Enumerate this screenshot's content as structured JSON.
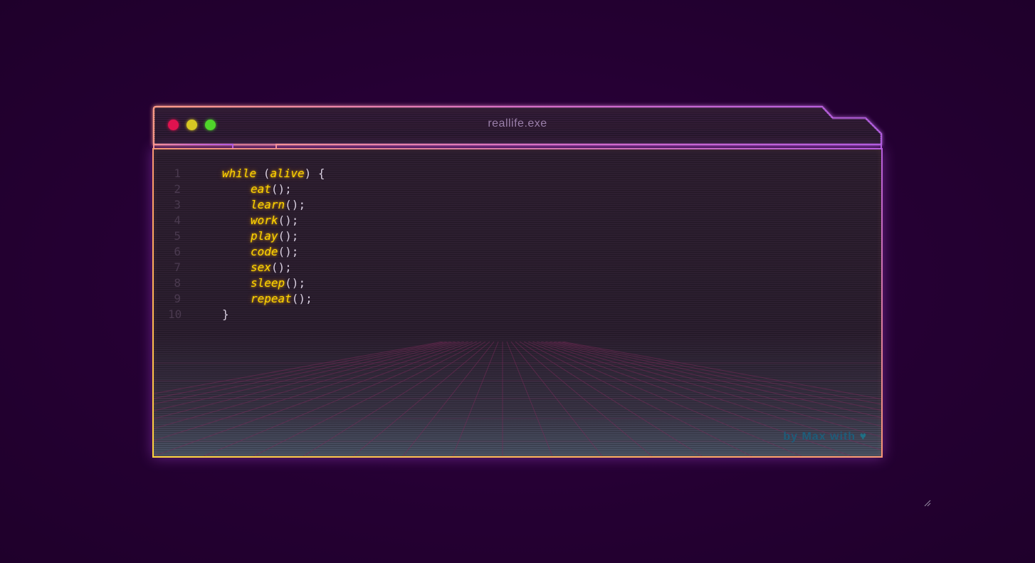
{
  "window": {
    "title": "reallife.exe",
    "controls": [
      "close-dot",
      "minimize-dot",
      "maximize-dot"
    ]
  },
  "colors": {
    "background": "#230031",
    "keyword": "#ffd400",
    "border_start": "#ffd53a",
    "border_mid": "#ff9d6a",
    "border_end": "#b95ee0",
    "close": "#e0124f",
    "minimize": "#d7c723",
    "maximize": "#4fd42a"
  },
  "code": {
    "lines": [
      {
        "n": "1",
        "parts": [
          {
            "t": "while",
            "c": "kw"
          },
          {
            "t": " (",
            "c": "punc"
          },
          {
            "t": "alive",
            "c": "kw"
          },
          {
            "t": ") {",
            "c": "punc"
          }
        ],
        "indent": 0
      },
      {
        "n": "2",
        "parts": [
          {
            "t": "eat",
            "c": "fn"
          },
          {
            "t": "();",
            "c": "punc"
          }
        ],
        "indent": 1
      },
      {
        "n": "3",
        "parts": [
          {
            "t": "learn",
            "c": "fn"
          },
          {
            "t": "();",
            "c": "punc"
          }
        ],
        "indent": 1
      },
      {
        "n": "4",
        "parts": [
          {
            "t": "work",
            "c": "fn"
          },
          {
            "t": "();",
            "c": "punc"
          }
        ],
        "indent": 1
      },
      {
        "n": "5",
        "parts": [
          {
            "t": "play",
            "c": "fn"
          },
          {
            "t": "();",
            "c": "punc"
          }
        ],
        "indent": 1
      },
      {
        "n": "6",
        "parts": [
          {
            "t": "code",
            "c": "fn"
          },
          {
            "t": "();",
            "c": "punc"
          }
        ],
        "indent": 1
      },
      {
        "n": "7",
        "parts": [
          {
            "t": "sex",
            "c": "fn"
          },
          {
            "t": "();",
            "c": "punc"
          }
        ],
        "indent": 1
      },
      {
        "n": "8",
        "parts": [
          {
            "t": "sleep",
            "c": "fn"
          },
          {
            "t": "();",
            "c": "punc"
          }
        ],
        "indent": 1
      },
      {
        "n": "9",
        "parts": [
          {
            "t": "repeat",
            "c": "fn"
          },
          {
            "t": "();",
            "c": "punc"
          }
        ],
        "indent": 1
      },
      {
        "n": "10",
        "parts": [
          {
            "t": "}",
            "c": "punc"
          }
        ],
        "indent": 0
      }
    ]
  },
  "credit": {
    "text": "by Max  with",
    "icon": "heart-icon",
    "heart": "♥"
  }
}
